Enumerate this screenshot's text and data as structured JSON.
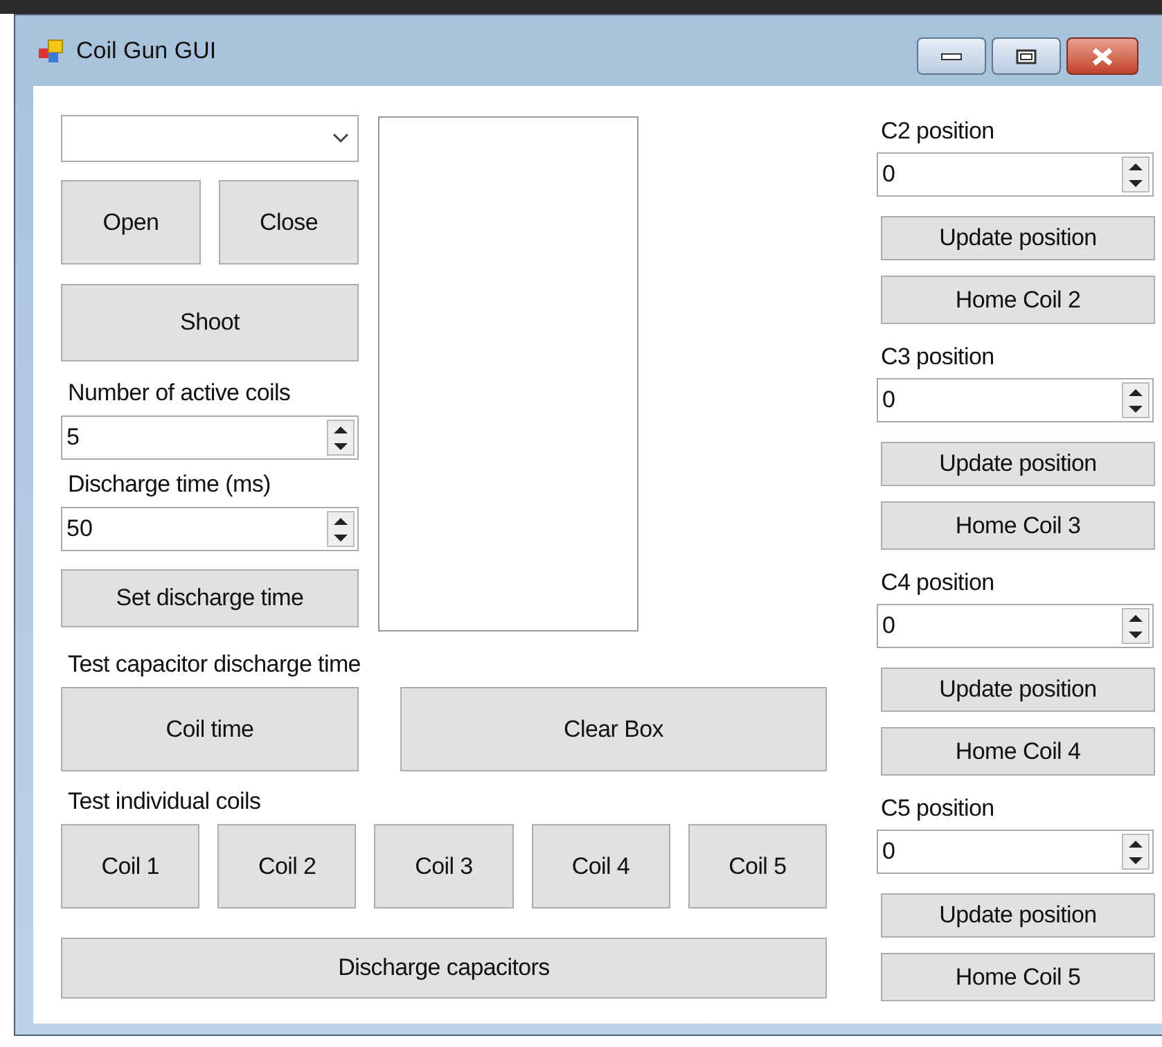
{
  "window": {
    "title": "Coil Gun GUI"
  },
  "connection_buttons": [
    "Open",
    "Close"
  ],
  "shoot_button": "Shoot",
  "active_coils": {
    "label": "Number of active coils",
    "value": "5"
  },
  "discharge_time": {
    "label": "Discharge time (ms)",
    "value": "50"
  },
  "set_discharge_button": "Set discharge time",
  "capacitor_test": {
    "label": "Test capacitor discharge time",
    "button": "Coil time"
  },
  "clear_button": "Clear Box",
  "individual_coils": {
    "label": "Test individual coils",
    "buttons": [
      "Coil 1",
      "Coil 2",
      "Coil 3",
      "Coil 4",
      "Coil 5"
    ]
  },
  "discharge_button": "Discharge capacitors",
  "positions": [
    {
      "label": "C2 position",
      "value": "0",
      "update_button": "Update position",
      "home_button": "Home Coil 2"
    },
    {
      "label": "C3 position",
      "value": "0",
      "update_button": "Update position",
      "home_button": "Home Coil 3"
    },
    {
      "label": "C4 position",
      "value": "0",
      "update_button": "Update position",
      "home_button": "Home Coil 4"
    },
    {
      "label": "C5 position",
      "value": "0",
      "update_button": "Update position",
      "home_button": "Home Coil 5"
    }
  ]
}
